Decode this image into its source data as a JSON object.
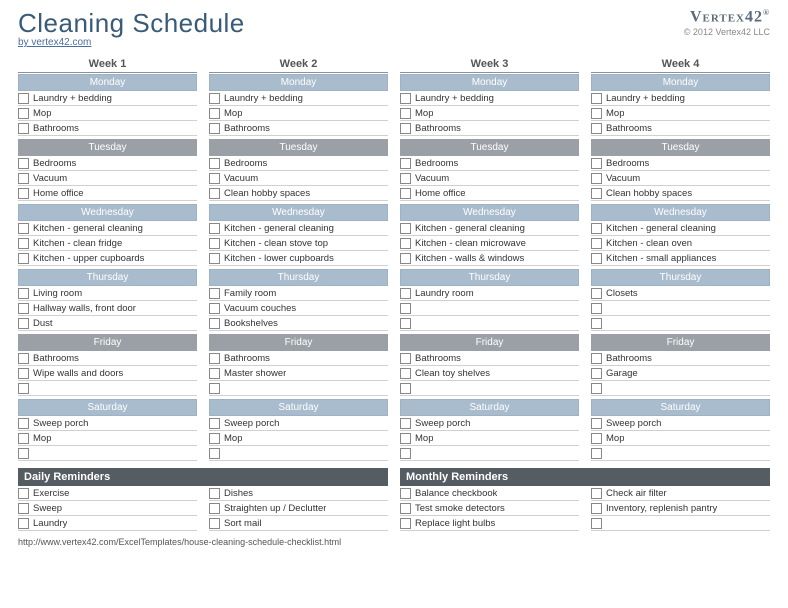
{
  "header": {
    "title": "Cleaning Schedule",
    "byline": "by vertex42.com",
    "logo": "Vertex42",
    "copyright": "© 2012 Vertex42 LLC"
  },
  "weeks": [
    {
      "label": "Week 1",
      "days": [
        {
          "name": "Monday",
          "color": "blue",
          "tasks": [
            "Laundry + bedding",
            "Mop",
            "Bathrooms"
          ]
        },
        {
          "name": "Tuesday",
          "color": "gray",
          "tasks": [
            "Bedrooms",
            "Vacuum",
            "Home office"
          ]
        },
        {
          "name": "Wednesday",
          "color": "blue",
          "tasks": [
            "Kitchen - general cleaning",
            "Kitchen - clean fridge",
            "Kitchen - upper cupboards"
          ]
        },
        {
          "name": "Thursday",
          "color": "blue",
          "tasks": [
            "Living room",
            "Hallway walls, front door",
            "Dust"
          ]
        },
        {
          "name": "Friday",
          "color": "gray",
          "tasks": [
            "Bathrooms",
            "Wipe walls and doors",
            ""
          ]
        },
        {
          "name": "Saturday",
          "color": "blue",
          "tasks": [
            "Sweep porch",
            "Mop",
            ""
          ]
        }
      ]
    },
    {
      "label": "Week 2",
      "days": [
        {
          "name": "Monday",
          "color": "blue",
          "tasks": [
            "Laundry + bedding",
            "Mop",
            "Bathrooms"
          ]
        },
        {
          "name": "Tuesday",
          "color": "gray",
          "tasks": [
            "Bedrooms",
            "Vacuum",
            "Clean hobby spaces"
          ]
        },
        {
          "name": "Wednesday",
          "color": "blue",
          "tasks": [
            "Kitchen - general cleaning",
            "Kitchen - clean stove top",
            "Kitchen - lower cupboards"
          ]
        },
        {
          "name": "Thursday",
          "color": "blue",
          "tasks": [
            "Family room",
            "Vacuum couches",
            "Bookshelves"
          ]
        },
        {
          "name": "Friday",
          "color": "gray",
          "tasks": [
            "Bathrooms",
            "Master shower",
            ""
          ]
        },
        {
          "name": "Saturday",
          "color": "blue",
          "tasks": [
            "Sweep porch",
            "Mop",
            ""
          ]
        }
      ]
    },
    {
      "label": "Week 3",
      "days": [
        {
          "name": "Monday",
          "color": "blue",
          "tasks": [
            "Laundry + bedding",
            "Mop",
            "Bathrooms"
          ]
        },
        {
          "name": "Tuesday",
          "color": "gray",
          "tasks": [
            "Bedrooms",
            "Vacuum",
            "Home office"
          ]
        },
        {
          "name": "Wednesday",
          "color": "blue",
          "tasks": [
            "Kitchen - general cleaning",
            "Kitchen - clean microwave",
            "Kitchen - walls & windows"
          ]
        },
        {
          "name": "Thursday",
          "color": "blue",
          "tasks": [
            "Laundry room",
            "",
            ""
          ]
        },
        {
          "name": "Friday",
          "color": "gray",
          "tasks": [
            "Bathrooms",
            "Clean toy shelves",
            ""
          ]
        },
        {
          "name": "Saturday",
          "color": "blue",
          "tasks": [
            "Sweep porch",
            "Mop",
            ""
          ]
        }
      ]
    },
    {
      "label": "Week 4",
      "days": [
        {
          "name": "Monday",
          "color": "blue",
          "tasks": [
            "Laundry + bedding",
            "Mop",
            "Bathrooms"
          ]
        },
        {
          "name": "Tuesday",
          "color": "gray",
          "tasks": [
            "Bedrooms",
            "Vacuum",
            "Clean hobby spaces"
          ]
        },
        {
          "name": "Wednesday",
          "color": "blue",
          "tasks": [
            "Kitchen - general cleaning",
            "Kitchen - clean oven",
            "Kitchen - small appliances"
          ]
        },
        {
          "name": "Thursday",
          "color": "blue",
          "tasks": [
            "Closets",
            "",
            ""
          ]
        },
        {
          "name": "Friday",
          "color": "gray",
          "tasks": [
            "Bathrooms",
            "Garage",
            ""
          ]
        },
        {
          "name": "Saturday",
          "color": "blue",
          "tasks": [
            "Sweep porch",
            "Mop",
            ""
          ]
        }
      ]
    }
  ],
  "reminders": {
    "daily": {
      "label": "Daily Reminders",
      "cols": [
        [
          "Exercise",
          "Sweep",
          "Laundry"
        ],
        [
          "Dishes",
          "Straighten up / Declutter",
          "Sort mail"
        ]
      ]
    },
    "monthly": {
      "label": "Monthly Reminders",
      "cols": [
        [
          "Balance checkbook",
          "Test smoke detectors",
          "Replace light bulbs"
        ],
        [
          "Check air filter",
          "Inventory, replenish pantry",
          ""
        ]
      ]
    }
  },
  "footer_url": "http://www.vertex42.com/ExcelTemplates/house-cleaning-schedule-checklist.html"
}
